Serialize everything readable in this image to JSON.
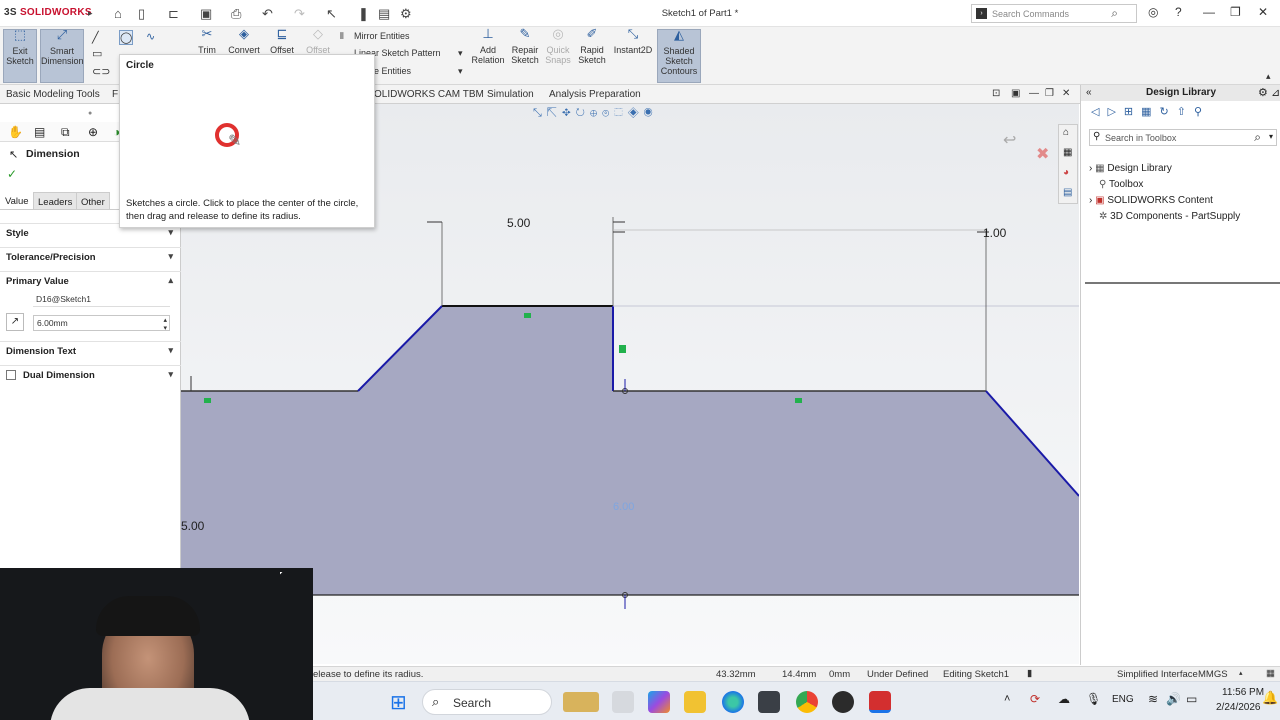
{
  "app": {
    "brand": "SOLIDWORKS",
    "brand_prefix": "3S",
    "title": "Sketch1 of Part1 *"
  },
  "search": {
    "placeholder": "Search Commands"
  },
  "ribbon": {
    "exit_sketch": "Exit Sketch",
    "smart_dimension": "Smart Dimension",
    "trim": "Trim",
    "convert": "Convert",
    "offset": "Offset",
    "offset2": "Offset",
    "mirror": "Mirror Entities",
    "linear_pattern": "Linear Sketch Pattern",
    "move_entities": "e Entities",
    "add_relation": "Add Relation",
    "repair_sketch": "Repair Sketch",
    "quick_snaps": "Quick Snaps",
    "rapid_sketch": "Rapid Sketch",
    "instant2d": "Instant2D",
    "shaded": "Shaded Sketch Contours"
  },
  "tabs": {
    "basic": "Basic Modeling Tools",
    "f": "F",
    "cam": "OLIDWORKS CAM TBM",
    "simulation": "Simulation",
    "analysis": "Analysis Preparation"
  },
  "tooltip": {
    "title": "Circle",
    "desc": "Sketches a circle. Click to place the center of the circle, then drag and release to define its radius."
  },
  "panel": {
    "title": "Dimension",
    "tabs": [
      "Value",
      "Leaders",
      "Other"
    ],
    "style": "Style",
    "tolerance": "Tolerance/Precision",
    "primary": "Primary Value",
    "dim_name": "D16@Sketch1",
    "dim_value": "6.00mm",
    "dim_text": "Dimension Text",
    "dual": "Dual Dimension"
  },
  "canvas": {
    "dim1": "5.00",
    "dim2": "1.00",
    "dim3": "6.00",
    "dim4": "5.00"
  },
  "library": {
    "title": "Design Library",
    "search_placeholder": "Search in Toolbox",
    "items": [
      "Design Library",
      "Toolbox",
      "SOLIDWORKS Content",
      "3D Components - PartSupply"
    ]
  },
  "status": {
    "hint": "elease to define its radius.",
    "x": "43.32mm",
    "y": "14.4mm",
    "z": "0mm",
    "state": "Under Defined",
    "editing": "Editing Sketch1",
    "interface": "Simplified Interface",
    "units": "MMGS"
  },
  "taskbar": {
    "search": "Search",
    "lang": "ENG",
    "time": "11:56 PM",
    "date": "2/24/2026"
  },
  "colors": {
    "accent": "#2d5f9e",
    "sketch_line": "#1a1aa8",
    "part_fill": "#a9abc6",
    "relation": "#22b14c"
  }
}
